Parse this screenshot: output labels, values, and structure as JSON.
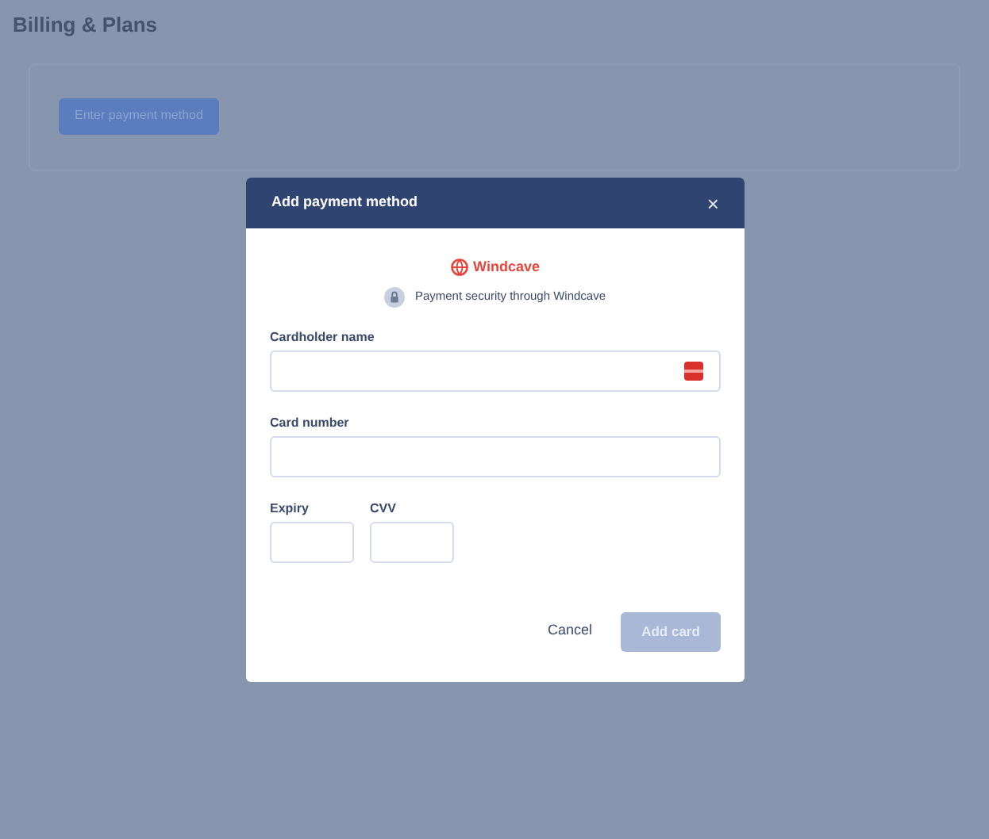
{
  "page": {
    "title": "Billing & Plans",
    "primary_button": "Enter payment method"
  },
  "dialog": {
    "title": "Add payment method",
    "close": "×",
    "provider": "Windcave",
    "security_note": "Payment security through Windcave",
    "fields": [
      {
        "kind": "wide",
        "label": "Cardholder name",
        "card_icon": true
      },
      {
        "kind": "wide",
        "label": "Card number",
        "card_icon": false
      },
      {
        "kind": "short",
        "label": "Expiry",
        "card_icon": false
      },
      {
        "kind": "short",
        "label": "CVV",
        "card_icon": false
      }
    ],
    "cancel": "Cancel",
    "submit": {
      "label": "Add card",
      "disabled": true
    }
  }
}
